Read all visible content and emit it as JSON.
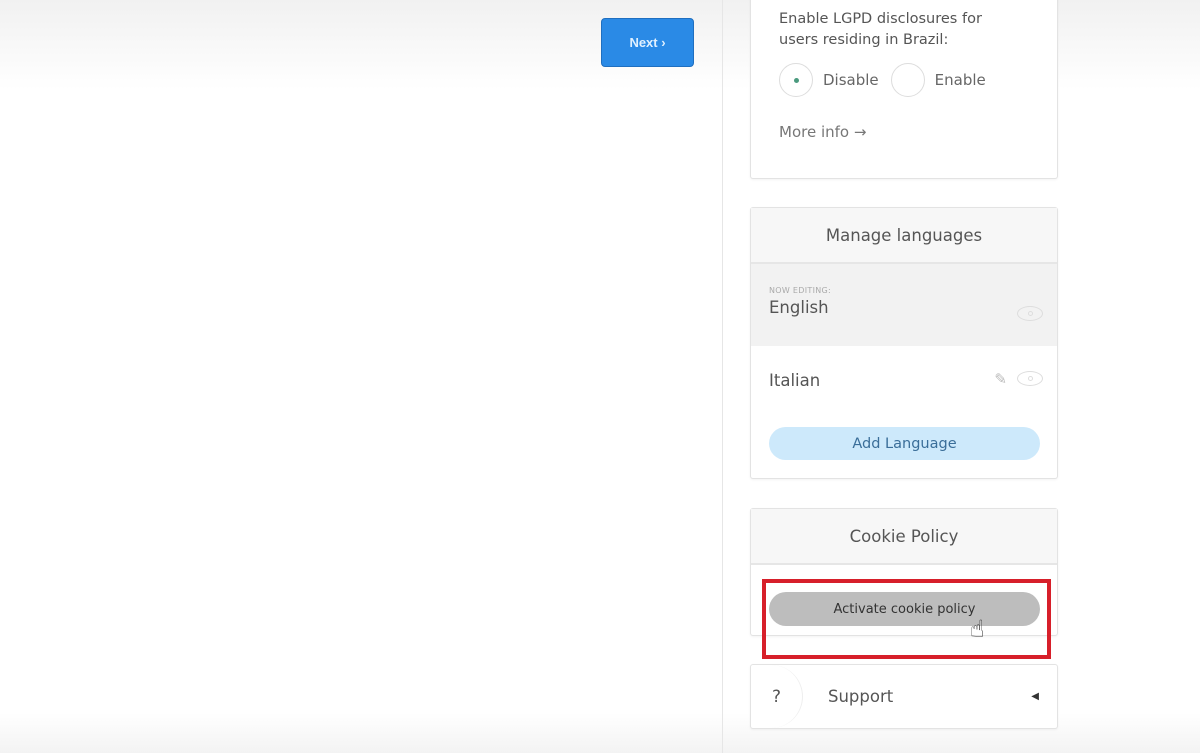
{
  "toolbar": {
    "next_label": "Next ›"
  },
  "lgpd": {
    "question": "Enable LGPD disclosures for users residing in Brazil:",
    "options": [
      {
        "label": "Disable",
        "selected": true
      },
      {
        "label": "Enable",
        "selected": false
      }
    ],
    "more_info": "More info →"
  },
  "languages": {
    "title": "Manage languages",
    "now_editing": "NOW EDITING:",
    "items": [
      {
        "label": "English"
      },
      {
        "label": "Italian"
      }
    ],
    "add_label": "Add Language"
  },
  "cookie": {
    "title": "Cookie Policy",
    "activate_label": "Activate cookie policy"
  },
  "support": {
    "icon": "?",
    "label": "Support"
  },
  "colors": {
    "accent": "#2a8ae6",
    "highlight": "#d71f2a"
  }
}
